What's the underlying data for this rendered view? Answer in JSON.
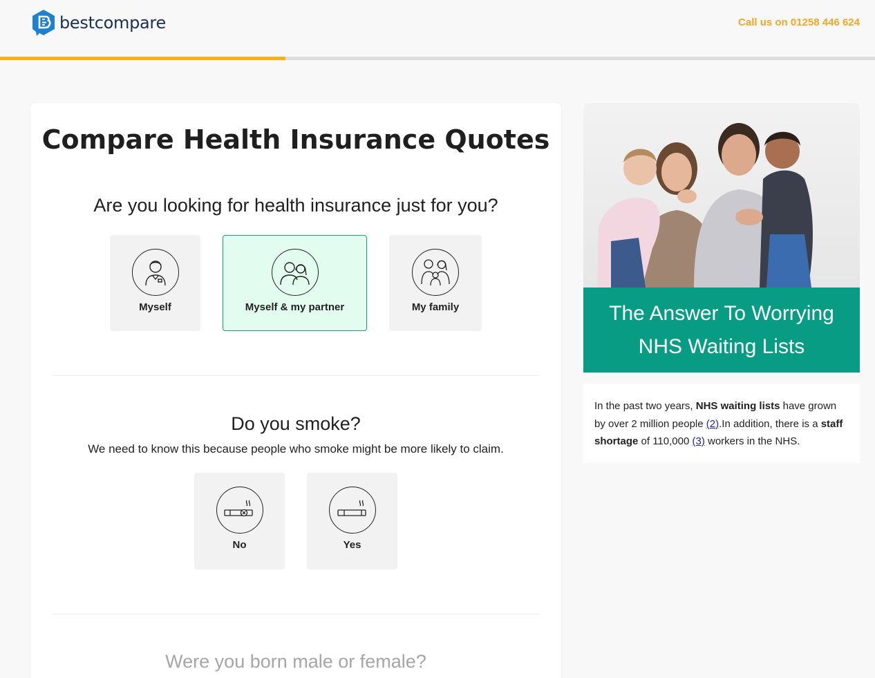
{
  "header": {
    "logo_text": "bestcompare",
    "phone": "Call us on 01258 446 624",
    "progress_percent": 32.6
  },
  "page_title": "Compare Health Insurance Quotes",
  "q1": {
    "title": "Are you looking for health insurance just for you?",
    "options": [
      {
        "label": "Myself",
        "icon": "person-icon",
        "selected": false
      },
      {
        "label": "Myself & my partner",
        "icon": "couple-icon",
        "selected": true
      },
      {
        "label": "My family",
        "icon": "family-icon",
        "selected": false
      }
    ]
  },
  "q2": {
    "title": "Do you smoke?",
    "subtitle": "We need to know this because people who smoke might be more likely to claim.",
    "options": [
      {
        "label": "No",
        "icon": "no-smoking-icon"
      },
      {
        "label": "Yes",
        "icon": "cigarette-icon"
      }
    ]
  },
  "q3": {
    "title": "Were you born male or female?"
  },
  "side": {
    "banner": "The Answer To Worrying NHS Waiting Lists",
    "info": {
      "t1": "In the past two years, ",
      "b1": "NHS waiting lists",
      "t2": " have grown by over 2 million people ",
      "link1": "(2)",
      "t3": ".In addition, there is a ",
      "b2": "staff shortage",
      "t4": " of 110,000 ",
      "link2": "(3)",
      "t5": " workers in the NHS."
    }
  },
  "colors": {
    "accent": "#f5a623",
    "teal": "#089c84",
    "selected_bg": "#e2fcef"
  }
}
